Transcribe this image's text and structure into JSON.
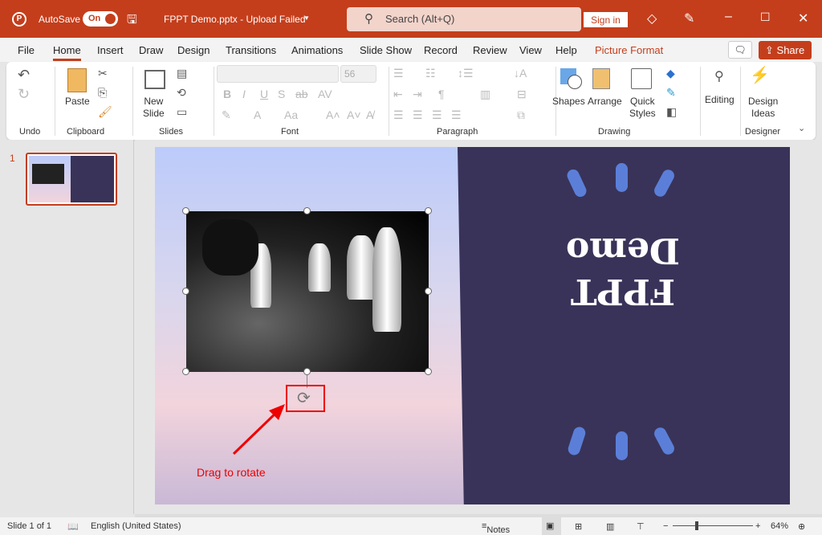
{
  "titlebar": {
    "autosave_label": "AutoSave",
    "autosave_state": "On",
    "doc_title": "FPPT Demo.pptx  -  Upload Failed",
    "search_placeholder": "Search (Alt+Q)",
    "sign_in": "Sign in",
    "accent": "#c43e1c"
  },
  "tabs": [
    "File",
    "Home",
    "Insert",
    "Draw",
    "Design",
    "Transitions",
    "Animations",
    "Slide Show",
    "Record",
    "Review",
    "View",
    "Help",
    "Picture Format"
  ],
  "active_tab": "Home",
  "share_label": "Share",
  "ribbon": {
    "groups": {
      "undo": "Undo",
      "clipboard": "Clipboard",
      "slides": "Slides",
      "font": "Font",
      "paragraph": "Paragraph",
      "drawing": "Drawing",
      "designer": "Designer"
    },
    "paste": "Paste",
    "new_slide_1": "New",
    "new_slide_2": "Slide",
    "font_name": "",
    "font_size": "56",
    "shapes": "Shapes",
    "arrange": "Arrange",
    "quick_1": "Quick",
    "quick_2": "Styles",
    "editing": "Editing",
    "design_1": "Design",
    "design_2": "Ideas"
  },
  "thumbnail": {
    "number": "1"
  },
  "slide": {
    "title": "FPPT Demo",
    "annotation": "Drag to rotate",
    "panel_color": "#393359",
    "tick_color": "#5b7fd8"
  },
  "status": {
    "slide_count": "Slide 1 of 1",
    "language": "English (United States)",
    "notes": "Notes",
    "zoom": "64%",
    "zoom_percent": 64
  }
}
